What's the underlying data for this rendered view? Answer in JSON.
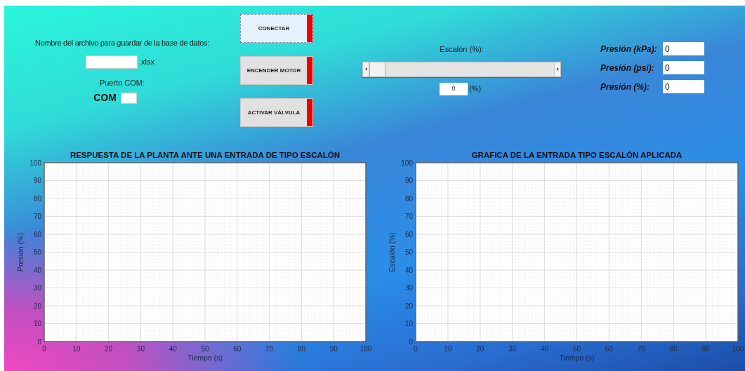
{
  "file_section": {
    "label": "Nombre del archivo para guardar de la base de datos:",
    "extension": ".xlsx",
    "port_label": "Puerto COM:",
    "port_prefix": "COM"
  },
  "buttons": [
    {
      "label": "CONECTAR",
      "focused": true,
      "on": false
    },
    {
      "label": "ENCENDER MOTOR",
      "focused": false,
      "on": false
    },
    {
      "label": "ACTIVAR VÁLVULA",
      "focused": false,
      "on": false
    }
  ],
  "step": {
    "label": "Escalón (%):",
    "slider": {
      "level": 0
    },
    "value": "0",
    "unit": "(%)"
  },
  "readings": [
    {
      "label": "Presión (kPa):",
      "value": "0"
    },
    {
      "label": "Presión (psi):",
      "value": "0"
    },
    {
      "label": "Presión (%):",
      "value": "0"
    }
  ],
  "charts": [
    {
      "chart_data": {
        "type": "line",
        "title": "RESPUESTA DE LA PLANTA ANTE UNA ENTRADA DE TIPO ESCALÓN",
        "grid": true,
        "xlabel": "Tiempo (s)",
        "ylabel": "Presión (%)",
        "xlim": [
          0,
          100
        ],
        "ylim": [
          0,
          100
        ],
        "xticks": [
          0,
          10,
          20,
          30,
          40,
          50,
          60,
          70,
          80,
          90,
          100
        ],
        "yticks": [
          0,
          10,
          20,
          30,
          40,
          50,
          60,
          70,
          80,
          90,
          100
        ]
      }
    },
    {
      "chart_data": {
        "type": "line",
        "title": "GRAFICA DE LA ENTRADA TIPO ESCALÓN APLICADA",
        "grid": true,
        "xlabel": "Tiempo (s)",
        "ylabel": "Escalón (%)",
        "xlim": [
          0,
          100
        ],
        "ylim": [
          0,
          100
        ],
        "xticks": [
          0,
          10,
          20,
          30,
          40,
          50,
          60,
          70,
          80,
          90,
          100
        ],
        "yticks": [
          0,
          10,
          20,
          30,
          40,
          50,
          60,
          70,
          80,
          90,
          100
        ]
      }
    }
  ]
}
